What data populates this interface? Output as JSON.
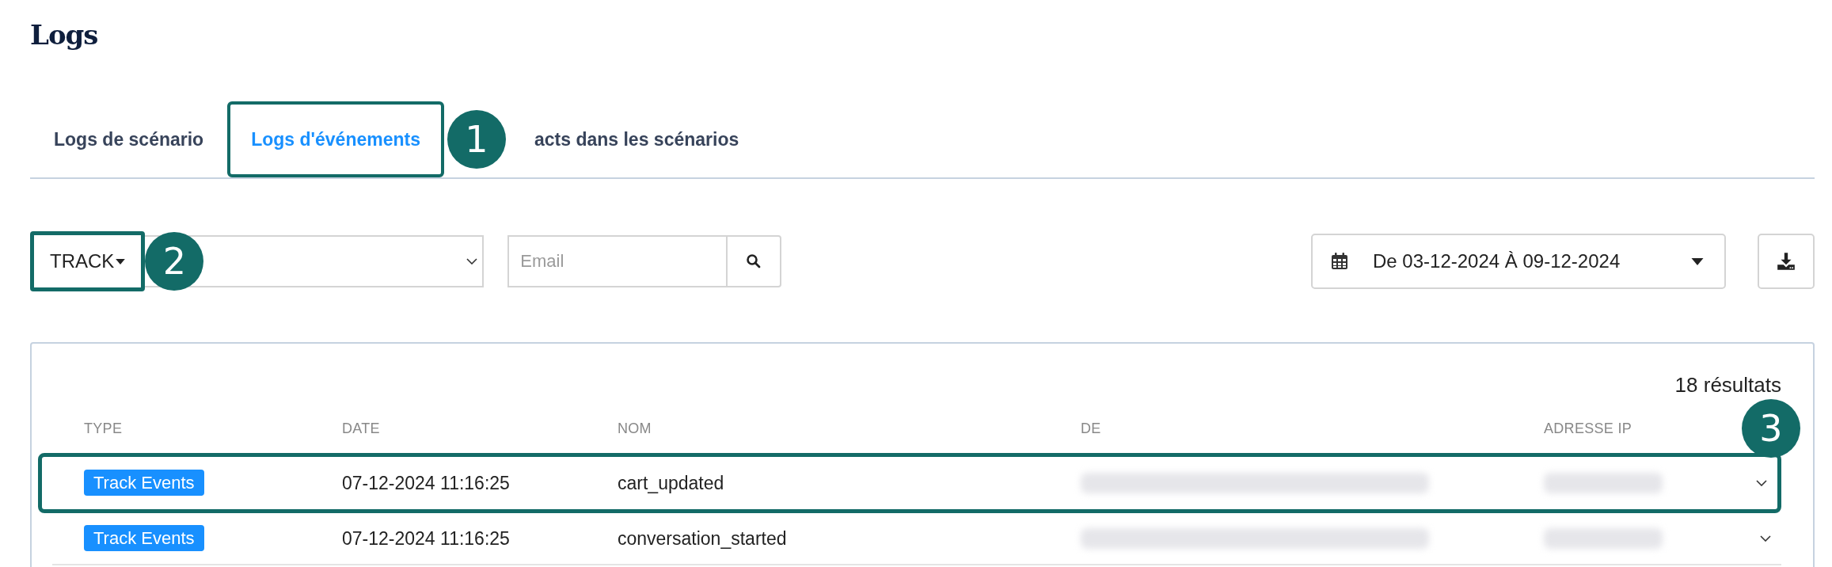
{
  "title": "Logs",
  "tabs": [
    {
      "label": "Logs de scénario",
      "selected": false,
      "annotated": false
    },
    {
      "label": "Logs d'événements",
      "selected": true,
      "annotated": true,
      "callout": "1"
    },
    {
      "label": "acts dans les scénarios",
      "selected": false,
      "annotated": false
    }
  ],
  "filters": {
    "type_button": {
      "label": "TRACK",
      "annotated": true,
      "callout": "2"
    },
    "email": {
      "placeholder": "Email"
    },
    "date_range": "De 03-12-2024 À 09-12-2024"
  },
  "results": {
    "count": "18 résultats",
    "callout": "3",
    "columns": [
      "TYPE",
      "DATE",
      "NOM",
      "DE",
      "ADRESSE IP"
    ],
    "rows": [
      {
        "type": "Track Events",
        "date": "07-12-2024 11:16:25",
        "name": "cart_updated",
        "annotated": true
      },
      {
        "type": "Track Events",
        "date": "07-12-2024 11:16:25",
        "name": "conversation_started",
        "annotated": false
      }
    ]
  }
}
